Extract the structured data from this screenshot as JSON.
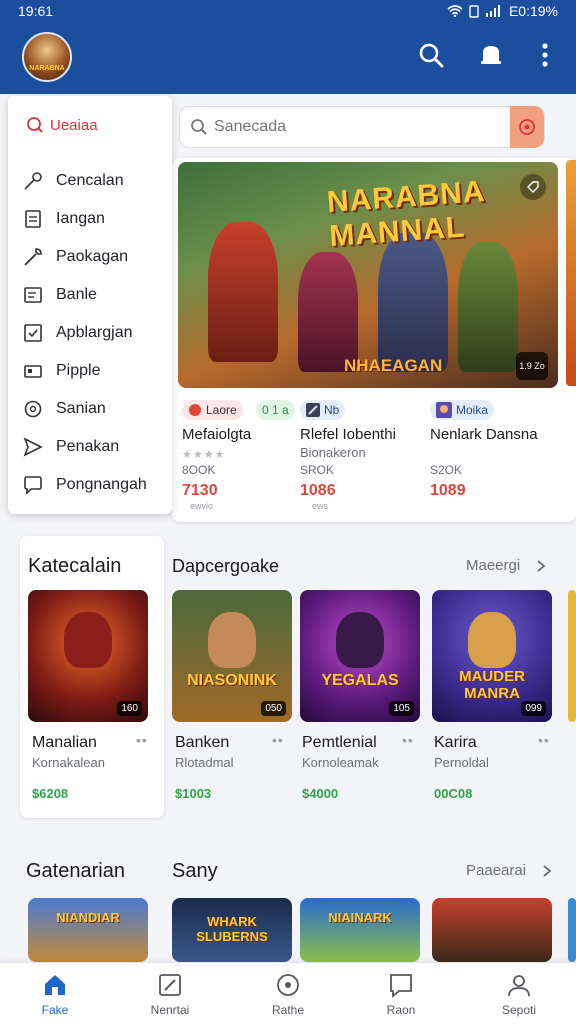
{
  "status": {
    "time": "19:61",
    "battery": "E0:19%"
  },
  "menu": {
    "header": "Ueaiaa",
    "items": [
      {
        "label": "Cencalan",
        "icon": "key-icon"
      },
      {
        "label": "Iangan",
        "icon": "document-icon"
      },
      {
        "label": "Paokagan",
        "icon": "wrench-icon"
      },
      {
        "label": "Banle",
        "icon": "list-icon"
      },
      {
        "label": "Apblargjan",
        "icon": "checklist-icon"
      },
      {
        "label": "Pipple",
        "icon": "card-icon"
      },
      {
        "label": "Sanian",
        "icon": "settings-icon"
      },
      {
        "label": "Penakan",
        "icon": "send-icon"
      },
      {
        "label": "Pongnangah",
        "icon": "chat-icon"
      }
    ]
  },
  "search": {
    "placeholder": "Sanecada"
  },
  "hero": {
    "title": "NARABNA MANNAL",
    "subtitle": "NHAEAGAN",
    "badge": "1.9 Zo",
    "games": [
      {
        "tag": "Laore",
        "tag2": "0 1 a",
        "title": "Mefaiolgta",
        "stars": "★★★★",
        "size": "8OOK",
        "price": "7130",
        "tiny": "ewvio"
      },
      {
        "tag": "Nb",
        "title": "Rlefel Iobenthi",
        "sub": "Bionakeron",
        "size": "SROK",
        "price": "1086",
        "tiny": "ews"
      },
      {
        "tag": "Moika",
        "title": "Nenlark Dansna",
        "size": "S2OK",
        "price": "1089"
      }
    ]
  },
  "sections": {
    "left_title": "Katecalain",
    "row1_title": "Dapcergoake",
    "row1_more": "Maeergi",
    "left2_title": "Gatenarian",
    "row2_title": "Sany",
    "row2_more": "Paaearai"
  },
  "cards": [
    {
      "title": "Manalian",
      "sub": "Kornakalean",
      "price": "$6208",
      "count": "160",
      "logo": ""
    },
    {
      "title": "Banken",
      "sub": "Rlotadmal",
      "price": "$1003",
      "count": "050",
      "logo": "NIASONINK"
    },
    {
      "title": "Pemtlenial",
      "sub": "Kornoleamak",
      "price": "$4000",
      "count": "105",
      "logo": "YEGALAS"
    },
    {
      "title": "Karira",
      "sub": "Pernoldal",
      "price": "00C08",
      "count": "099",
      "logo": "MAUDER MANRA"
    }
  ],
  "row2_logos": [
    "NIANDIAR",
    "WHARK SLUBERNS",
    "NIAINARK",
    ""
  ],
  "nav": [
    {
      "label": "Fake",
      "icon": "home-icon"
    },
    {
      "label": "Nenrtai",
      "icon": "edit-icon"
    },
    {
      "label": "Rathe",
      "icon": "target-icon"
    },
    {
      "label": "Raon",
      "icon": "chat-icon"
    },
    {
      "label": "Sepoti",
      "icon": "person-icon"
    }
  ]
}
